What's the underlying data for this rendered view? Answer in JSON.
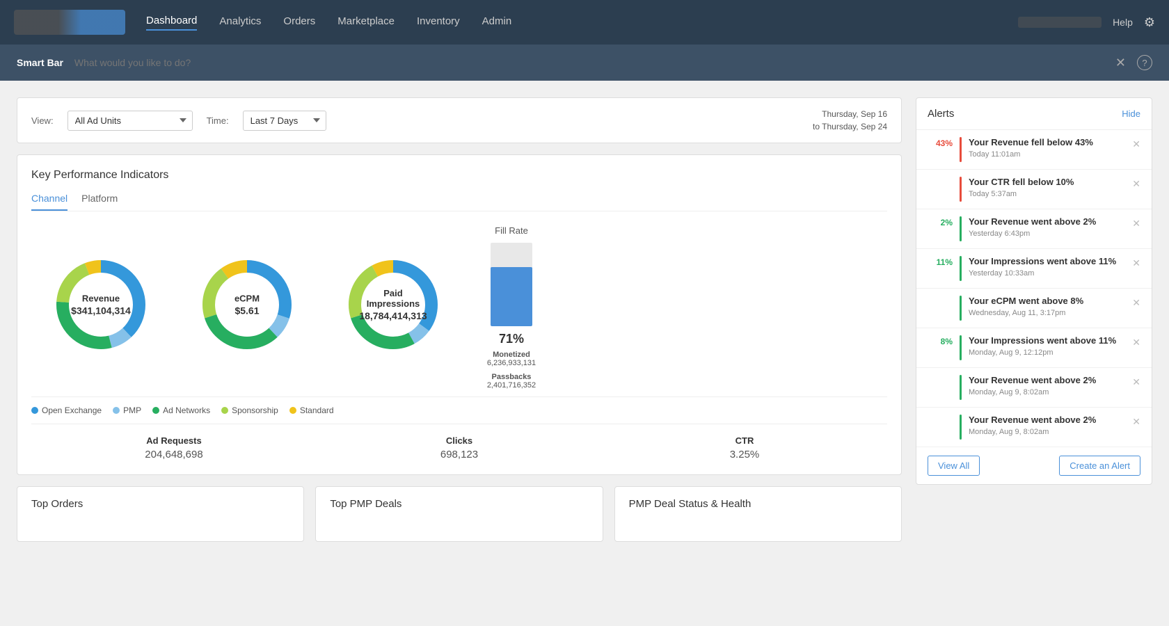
{
  "nav": {
    "links": [
      {
        "label": "Dashboard",
        "active": true
      },
      {
        "label": "Analytics",
        "active": false
      },
      {
        "label": "Orders",
        "active": false
      },
      {
        "label": "Marketplace",
        "active": false
      },
      {
        "label": "Inventory",
        "active": false
      },
      {
        "label": "Admin",
        "active": false
      }
    ],
    "help_label": "Help"
  },
  "smartbar": {
    "label": "Smart Bar",
    "placeholder": "What would you like to do?"
  },
  "filters": {
    "view_label": "View:",
    "view_value": "All Ad Units",
    "time_label": "Time:",
    "time_value": "Last 7 Days",
    "date_line1": "Thursday, Sep 16",
    "date_line2": "to Thursday, Sep 24"
  },
  "kpi": {
    "title": "Key Performance Indicators",
    "tabs": [
      "Channel",
      "Platform"
    ],
    "active_tab": "Channel",
    "charts": [
      {
        "label": "Revenue",
        "value": "$341,104,314",
        "segments": [
          {
            "color": "#3498db",
            "pct": 38
          },
          {
            "color": "#85c1e9",
            "pct": 8
          },
          {
            "color": "#27ae60",
            "pct": 30
          },
          {
            "color": "#a8d44b",
            "pct": 18
          },
          {
            "color": "#f0c31b",
            "pct": 6
          }
        ]
      },
      {
        "label": "eCPM",
        "value": "$5.61",
        "segments": [
          {
            "color": "#3498db",
            "pct": 30
          },
          {
            "color": "#85c1e9",
            "pct": 8
          },
          {
            "color": "#27ae60",
            "pct": 32
          },
          {
            "color": "#a8d44b",
            "pct": 20
          },
          {
            "color": "#f0c31b",
            "pct": 10
          }
        ]
      },
      {
        "label": "Paid Impressions",
        "value": "18,784,414,313",
        "segments": [
          {
            "color": "#3498db",
            "pct": 35
          },
          {
            "color": "#85c1e9",
            "pct": 7
          },
          {
            "color": "#27ae60",
            "pct": 28
          },
          {
            "color": "#a8d44b",
            "pct": 22
          },
          {
            "color": "#f0c31b",
            "pct": 8
          }
        ]
      }
    ],
    "fill_rate": {
      "title": "Fill Rate",
      "pct": 71,
      "pct_label": "71%",
      "monetized_label": "Monetized",
      "monetized_value": "6,236,933,131",
      "passbacks_label": "Passbacks",
      "passbacks_value": "2,401,716,352"
    },
    "legend": [
      {
        "color": "#3498db",
        "label": "Open Exchange"
      },
      {
        "color": "#85c1e9",
        "label": "PMP"
      },
      {
        "color": "#27ae60",
        "label": "Ad Networks"
      },
      {
        "color": "#a8d44b",
        "label": "Sponsorship"
      },
      {
        "color": "#f0c31b",
        "label": "Standard"
      }
    ],
    "stats": [
      {
        "label": "Ad Requests",
        "value": "204,648,698"
      },
      {
        "label": "Clicks",
        "value": "698,123"
      },
      {
        "label": "CTR",
        "value": "3.25%"
      }
    ]
  },
  "alerts": {
    "title": "Alerts",
    "hide_label": "Hide",
    "items": [
      {
        "badge": "43%",
        "badge_color": "red",
        "bar_color": "red",
        "text": "Your Revenue fell below 43%",
        "time": "Today 11:01am"
      },
      {
        "badge": "",
        "badge_color": "red",
        "bar_color": "red",
        "text": "Your CTR fell below 10%",
        "time": "Today 5:37am"
      },
      {
        "badge": "2%",
        "badge_color": "green",
        "bar_color": "green",
        "text": "Your Revenue went above 2%",
        "time": "Yesterday 6:43pm"
      },
      {
        "badge": "11%",
        "badge_color": "green",
        "bar_color": "green",
        "text": "Your Impressions went above 11%",
        "time": "Yesterday 10:33am"
      },
      {
        "badge": "",
        "badge_color": "green",
        "bar_color": "green",
        "text": "Your eCPM went above 8%",
        "time": "Wednesday, Aug 11, 3:17pm"
      },
      {
        "badge": "8%",
        "badge_color": "green",
        "bar_color": "green",
        "text": "Your Impressions went above 11%",
        "time": "Monday, Aug 9, 12:12pm"
      },
      {
        "badge": "",
        "badge_color": "green",
        "bar_color": "green",
        "text": "Your Revenue went above 2%",
        "time": "Monday, Aug 9, 8:02am"
      },
      {
        "badge": "",
        "badge_color": "green",
        "bar_color": "green",
        "text": "Your Revenue went above 2%",
        "time": "Monday, Aug 9, 8:02am"
      }
    ],
    "view_all_label": "View All",
    "create_alert_label": "Create an Alert"
  },
  "bottom_cards": [
    {
      "title": "Top Orders"
    },
    {
      "title": "Top PMP Deals"
    },
    {
      "title": "PMP Deal Status & Health"
    }
  ]
}
